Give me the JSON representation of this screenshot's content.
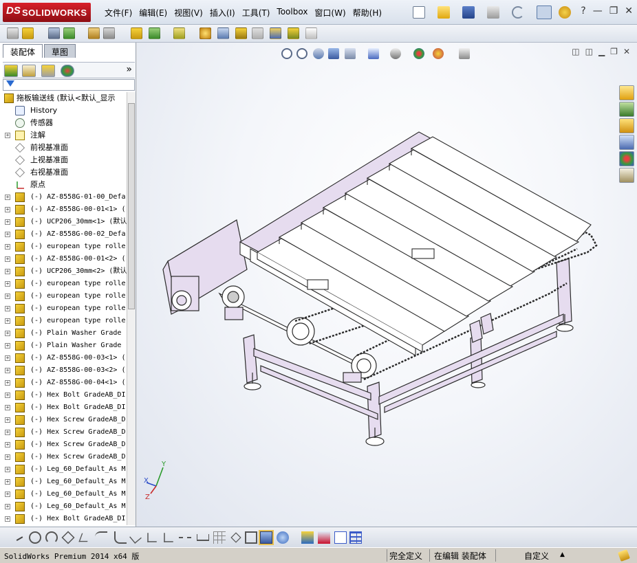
{
  "app": {
    "logo_prefix": "DS",
    "logo_name": "SOLIDWORKS"
  },
  "menu": [
    {
      "label": "文件(F)"
    },
    {
      "label": "编辑(E)"
    },
    {
      "label": "视图(V)"
    },
    {
      "label": "插入(I)"
    },
    {
      "label": "工具(T)"
    },
    {
      "label": "Toolbox"
    },
    {
      "label": "窗口(W)"
    },
    {
      "label": "帮助(H)"
    }
  ],
  "window_controls": {
    "minimize": "—",
    "restore": "❐",
    "close": "✕",
    "help": "?"
  },
  "feature_manager": {
    "tabs": [
      {
        "label": "装配体"
      },
      {
        "label": "草图"
      }
    ],
    "expand_arrows": "»",
    "filter_icon": "filter-icon",
    "root": {
      "label": "拖板输送线  (默认<默认_显示"
    },
    "items": [
      {
        "label": "History",
        "icon": "history-icon",
        "expandable": false
      },
      {
        "label": "传感器",
        "icon": "sensor-icon",
        "expandable": false
      },
      {
        "label": "注解",
        "icon": "annotation-icon",
        "expandable": true
      },
      {
        "label": "前视基准面",
        "icon": "plane-icon",
        "expandable": false
      },
      {
        "label": "上视基准面",
        "icon": "plane-icon",
        "expandable": false
      },
      {
        "label": "右视基准面",
        "icon": "plane-icon",
        "expandable": false
      },
      {
        "label": "原点",
        "icon": "origin-icon",
        "expandable": false
      },
      {
        "label": "(-) AZ-8558G-01-00_Defa",
        "icon": "part-icon",
        "expandable": true
      },
      {
        "label": "(-) AZ-8558G-00-01<1> (",
        "icon": "part-icon",
        "expandable": true
      },
      {
        "label": "(-) UCP206_30mm<1> (默认",
        "icon": "part-icon",
        "expandable": true
      },
      {
        "label": "(-) AZ-8558G-00-02_Defa",
        "icon": "part-icon",
        "expandable": true
      },
      {
        "label": "(-) european type rolle",
        "icon": "part-icon",
        "expandable": true
      },
      {
        "label": "(-) AZ-8558G-00-01<2> (",
        "icon": "part-icon",
        "expandable": true
      },
      {
        "label": "(-) UCP206_30mm<2> (默认",
        "icon": "part-icon",
        "expandable": true
      },
      {
        "label": "(-) european type rolle",
        "icon": "part-icon",
        "expandable": true
      },
      {
        "label": "(-) european type rolle",
        "icon": "part-icon",
        "expandable": true
      },
      {
        "label": "(-) european type rolle",
        "icon": "part-icon",
        "expandable": true
      },
      {
        "label": "(-) european type rolle",
        "icon": "part-icon",
        "expandable": true
      },
      {
        "label": "(-) Plain Washer Grade",
        "icon": "part-icon",
        "expandable": true
      },
      {
        "label": "(-) Plain Washer Grade",
        "icon": "part-icon",
        "expandable": true
      },
      {
        "label": "(-) AZ-8558G-00-03<1> (",
        "icon": "part-icon",
        "expandable": true
      },
      {
        "label": "(-) AZ-8558G-00-03<2> (",
        "icon": "part-icon",
        "expandable": true
      },
      {
        "label": "(-) AZ-8558G-00-04<1> (",
        "icon": "part-icon",
        "expandable": true
      },
      {
        "label": "(-) Hex Bolt GradeAB_DI",
        "icon": "part-icon",
        "expandable": true
      },
      {
        "label": "(-) Hex Bolt GradeAB_DI",
        "icon": "part-icon",
        "expandable": true
      },
      {
        "label": "(-) Hex Screw GradeAB_D",
        "icon": "part-icon",
        "expandable": true
      },
      {
        "label": "(-) Hex Screw GradeAB_D",
        "icon": "part-icon",
        "expandable": true
      },
      {
        "label": "(-) Hex Screw GradeAB_D",
        "icon": "part-icon",
        "expandable": true
      },
      {
        "label": "(-) Hex Screw GradeAB_D",
        "icon": "part-icon",
        "expandable": true
      },
      {
        "label": "(-) Leg_60_Default_As M",
        "icon": "part-icon",
        "expandable": true
      },
      {
        "label": "(-) Leg_60_Default_As M",
        "icon": "part-icon",
        "expandable": true
      },
      {
        "label": "(-) Leg_60_Default_As M",
        "icon": "part-icon",
        "expandable": true
      },
      {
        "label": "(-) Leg_60_Default_As M",
        "icon": "part-icon",
        "expandable": true
      },
      {
        "label": "(-) Hex Bolt GradeAB_DI",
        "icon": "part-icon",
        "expandable": true
      }
    ]
  },
  "axes_triad": {
    "x": "X",
    "y": "Y",
    "z": "Z"
  },
  "status": {
    "product": "SolidWorks Premium 2014 x64 版",
    "definition": "完全定义",
    "mode": "在编辑 装配体",
    "units": "自定义",
    "units_arrow": "▲"
  },
  "colors": {
    "accent": "#c8102e",
    "model_purple": "#e6dcef",
    "model_edge": "#2a2a2a"
  }
}
